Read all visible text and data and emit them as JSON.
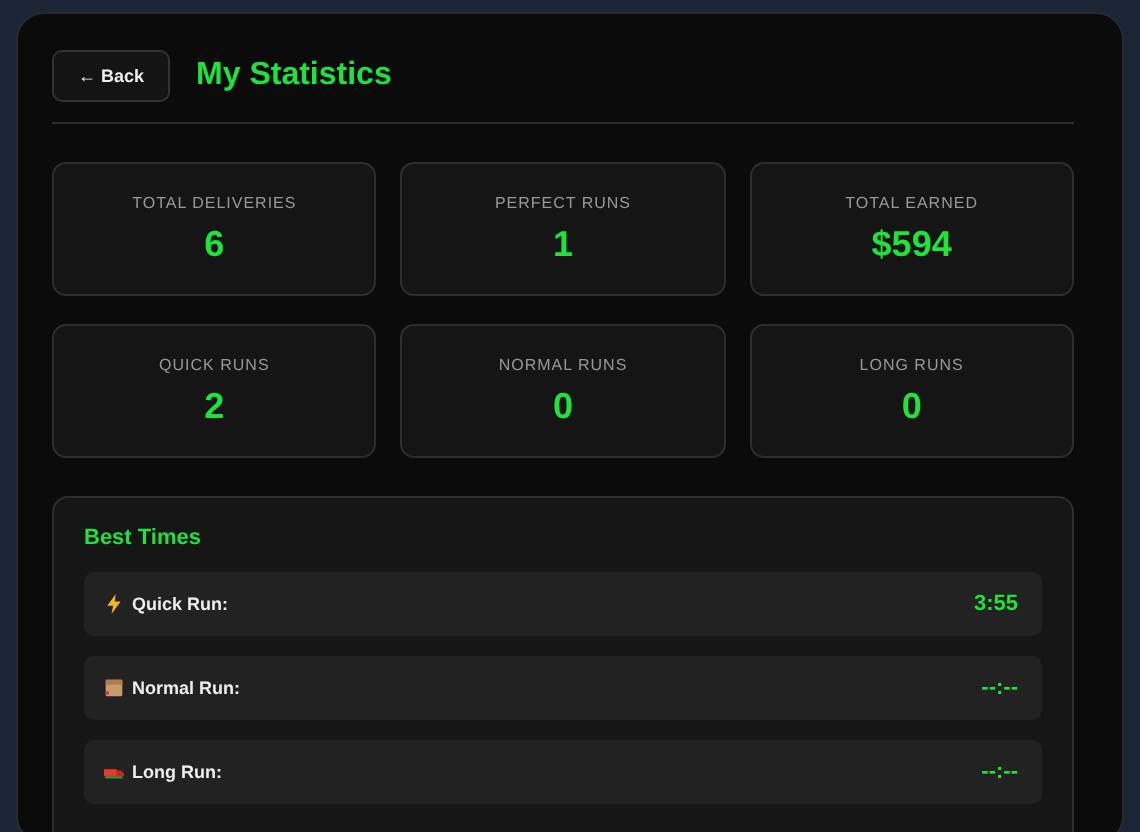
{
  "header": {
    "back_button": "← Back",
    "title": "My Statistics"
  },
  "stats": [
    {
      "label": "TOTAL DELIVERIES",
      "value": "6"
    },
    {
      "label": "PERFECT RUNS",
      "value": "1"
    },
    {
      "label": "TOTAL EARNED",
      "value": "$594"
    },
    {
      "label": "QUICK RUNS",
      "value": "2"
    },
    {
      "label": "NORMAL RUNS",
      "value": "0"
    },
    {
      "label": "LONG RUNS",
      "value": "0"
    }
  ],
  "best_times": {
    "title": "Best Times",
    "rows": [
      {
        "kind": "quick",
        "label": "Quick Run:",
        "time": "3:55"
      },
      {
        "kind": "normal",
        "label": "Normal Run:",
        "time": "--:--"
      },
      {
        "kind": "long",
        "label": "Long Run:",
        "time": "--:--"
      }
    ]
  }
}
